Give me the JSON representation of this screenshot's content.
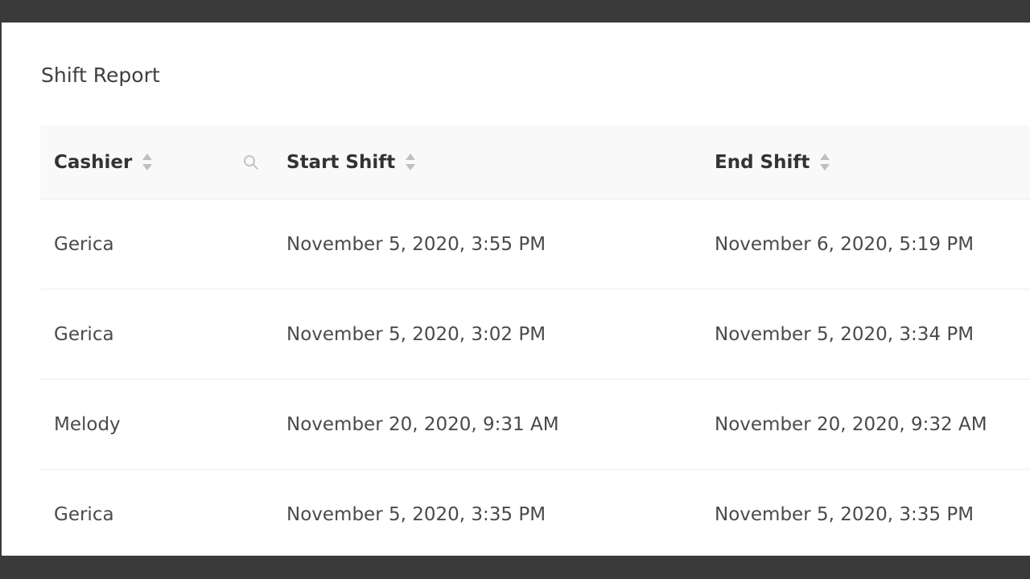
{
  "page": {
    "title": "Shift Report"
  },
  "table": {
    "columns": {
      "cashier": "Cashier",
      "start_shift": "Start Shift",
      "end_shift": "End Shift"
    },
    "rows": [
      {
        "cashier": "Gerica",
        "start": "November 5, 2020, 3:55 PM",
        "end": "November 6, 2020, 5:19 PM"
      },
      {
        "cashier": "Gerica",
        "start": "November 5, 2020, 3:02 PM",
        "end": "November 5, 2020, 3:34 PM"
      },
      {
        "cashier": "Melody",
        "start": "November 20, 2020, 9:31 AM",
        "end": "November 20, 2020, 9:32 AM"
      },
      {
        "cashier": "Gerica",
        "start": "November 5, 2020, 3:35 PM",
        "end": "November 5, 2020, 3:35 PM"
      }
    ]
  },
  "icons": {
    "sort": "sort-icon",
    "search": "search-icon"
  },
  "colors": {
    "background": "#3a3a3a",
    "header_bg": "#f9f9f9",
    "divider": "#ececec",
    "icon": "#bfbfbf"
  }
}
